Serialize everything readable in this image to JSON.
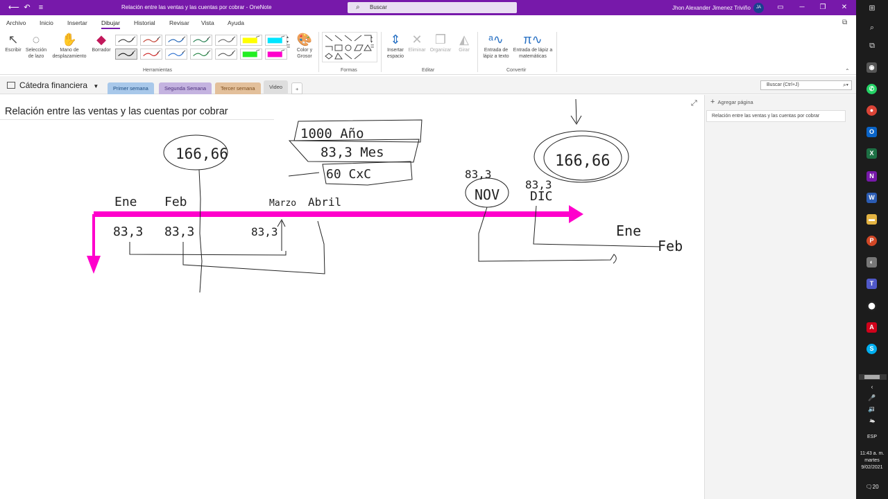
{
  "window": {
    "title": "Relación entre las ventas y las cuentas por cobrar  -  OneNote",
    "search_label": "Buscar",
    "user_name": "Jhon Alexander Jimenez Triviño",
    "user_initials": "JA"
  },
  "menu": [
    {
      "label": "Archivo"
    },
    {
      "label": "Inicio"
    },
    {
      "label": "Insertar"
    },
    {
      "label": "Dibujar"
    },
    {
      "label": "Historial"
    },
    {
      "label": "Revisar"
    },
    {
      "label": "Vista"
    },
    {
      "label": "Ayuda"
    }
  ],
  "ribbon": {
    "tools": {
      "write": "Escribir",
      "lasso": "Selección de lazo",
      "hand": "Mano de desplazamiento",
      "eraser": "Borrador",
      "color": "Color y Grosor",
      "group": "Herramientas"
    },
    "shapes_group": "Formas",
    "edit": {
      "insert_space": "Insertar espacio",
      "delete": "Eliminar",
      "arrange": "Organizar",
      "rotate": "Girar",
      "group": "Editar"
    },
    "convert": {
      "ink_to_text": "Entrada de lápiz a texto",
      "ink_to_math": "Entrada de lápiz a matemáticas",
      "group": "Convertir"
    }
  },
  "pens": [
    {
      "color": "#333333"
    },
    {
      "color": "#c0392b"
    },
    {
      "color": "#1a5fb4"
    },
    {
      "color": "#1e7b4a"
    },
    {
      "color": "#666666"
    },
    {
      "color": "#ffff00"
    },
    {
      "color": "#00e5ff"
    },
    {
      "color": "#111111"
    },
    {
      "color": "#cc2020"
    },
    {
      "color": "#2a6fd0"
    },
    {
      "color": "#208040"
    },
    {
      "color": "#555555"
    },
    {
      "color": "#22ee22"
    },
    {
      "color": "#ff00cc"
    }
  ],
  "notebook": {
    "name": "Cátedra financiera",
    "sections": [
      {
        "label": "Primer semana"
      },
      {
        "label": "Segunda Semana"
      },
      {
        "label": "Tercer semana"
      },
      {
        "label": "Video"
      }
    ],
    "add_section": "+",
    "search_placeholder": "Buscar (Ctrl+J)"
  },
  "page": {
    "title": "Relación entre las ventas y las cuentas por cobrar"
  },
  "ink": {
    "box_year": "1000  Año",
    "box_month": "83,3  Mes",
    "box_cxc": "60   CxC",
    "bubble_feb": "166,66",
    "bubble_dic": "166,66",
    "nov_label": "NOV",
    "nov_value": "83,3",
    "dic_label": "DIC",
    "dic_value": "83,3",
    "ene": "Ene",
    "feb": "Feb",
    "marzo": "Marzo",
    "abril": "Abril",
    "v_ene": "83,3",
    "v_feb": "83,3",
    "v_mar": "83,3",
    "ene_next": "Ene",
    "feb_next": "Feb",
    "arrow_color": "#ff00cc"
  },
  "pane": {
    "add_page": "Agregar página",
    "pages": [
      {
        "label": "Relación entre las ventas y las cuentas por cobrar"
      }
    ]
  },
  "system": {
    "language": "ESP",
    "time": "11:43 a. m.",
    "day": "martes",
    "date": "9/02/2021",
    "notifications": "20"
  }
}
